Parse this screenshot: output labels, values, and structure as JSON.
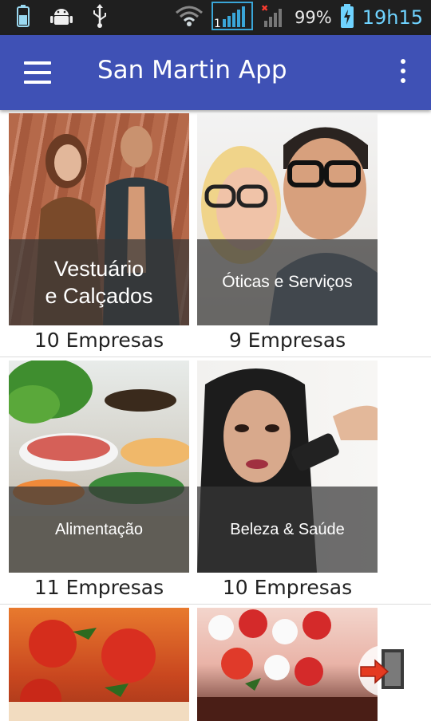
{
  "status_bar": {
    "battery_percent": "99%",
    "clock": "19h15",
    "icons": [
      "battery-icon",
      "android-icon",
      "usb-icon",
      "wifi-icon",
      "signal-icon",
      "no-signal-icon",
      "charging-battery-icon"
    ]
  },
  "app_bar": {
    "title": "San Martin App",
    "menu_icon": "hamburger-menu-icon",
    "overflow_icon": "overflow-menu-icon",
    "color": "#3f51b5"
  },
  "categories": [
    {
      "label_line1": "Vestuário",
      "label_line2": "e Calçados",
      "count": "10 Empresas",
      "image": "clothing-photo"
    },
    {
      "label_line1": "Óticas e Serviços",
      "label_line2": "",
      "count": "9 Empresas",
      "image": "optics-photo"
    },
    {
      "label_line1": "Alimentação",
      "label_line2": "",
      "count": "11 Empresas",
      "image": "food-buffet-photo"
    },
    {
      "label_line1": "Beleza & Saúde",
      "label_line2": "",
      "count": "10 Empresas",
      "image": "beauty-photo"
    },
    {
      "label_line1": "",
      "label_line2": "",
      "count": "",
      "image": "pizza-photo"
    },
    {
      "label_line1": "",
      "label_line2": "",
      "count": "",
      "image": "cake-photo"
    }
  ],
  "exit_button": {
    "icon": "exit-door-icon"
  }
}
